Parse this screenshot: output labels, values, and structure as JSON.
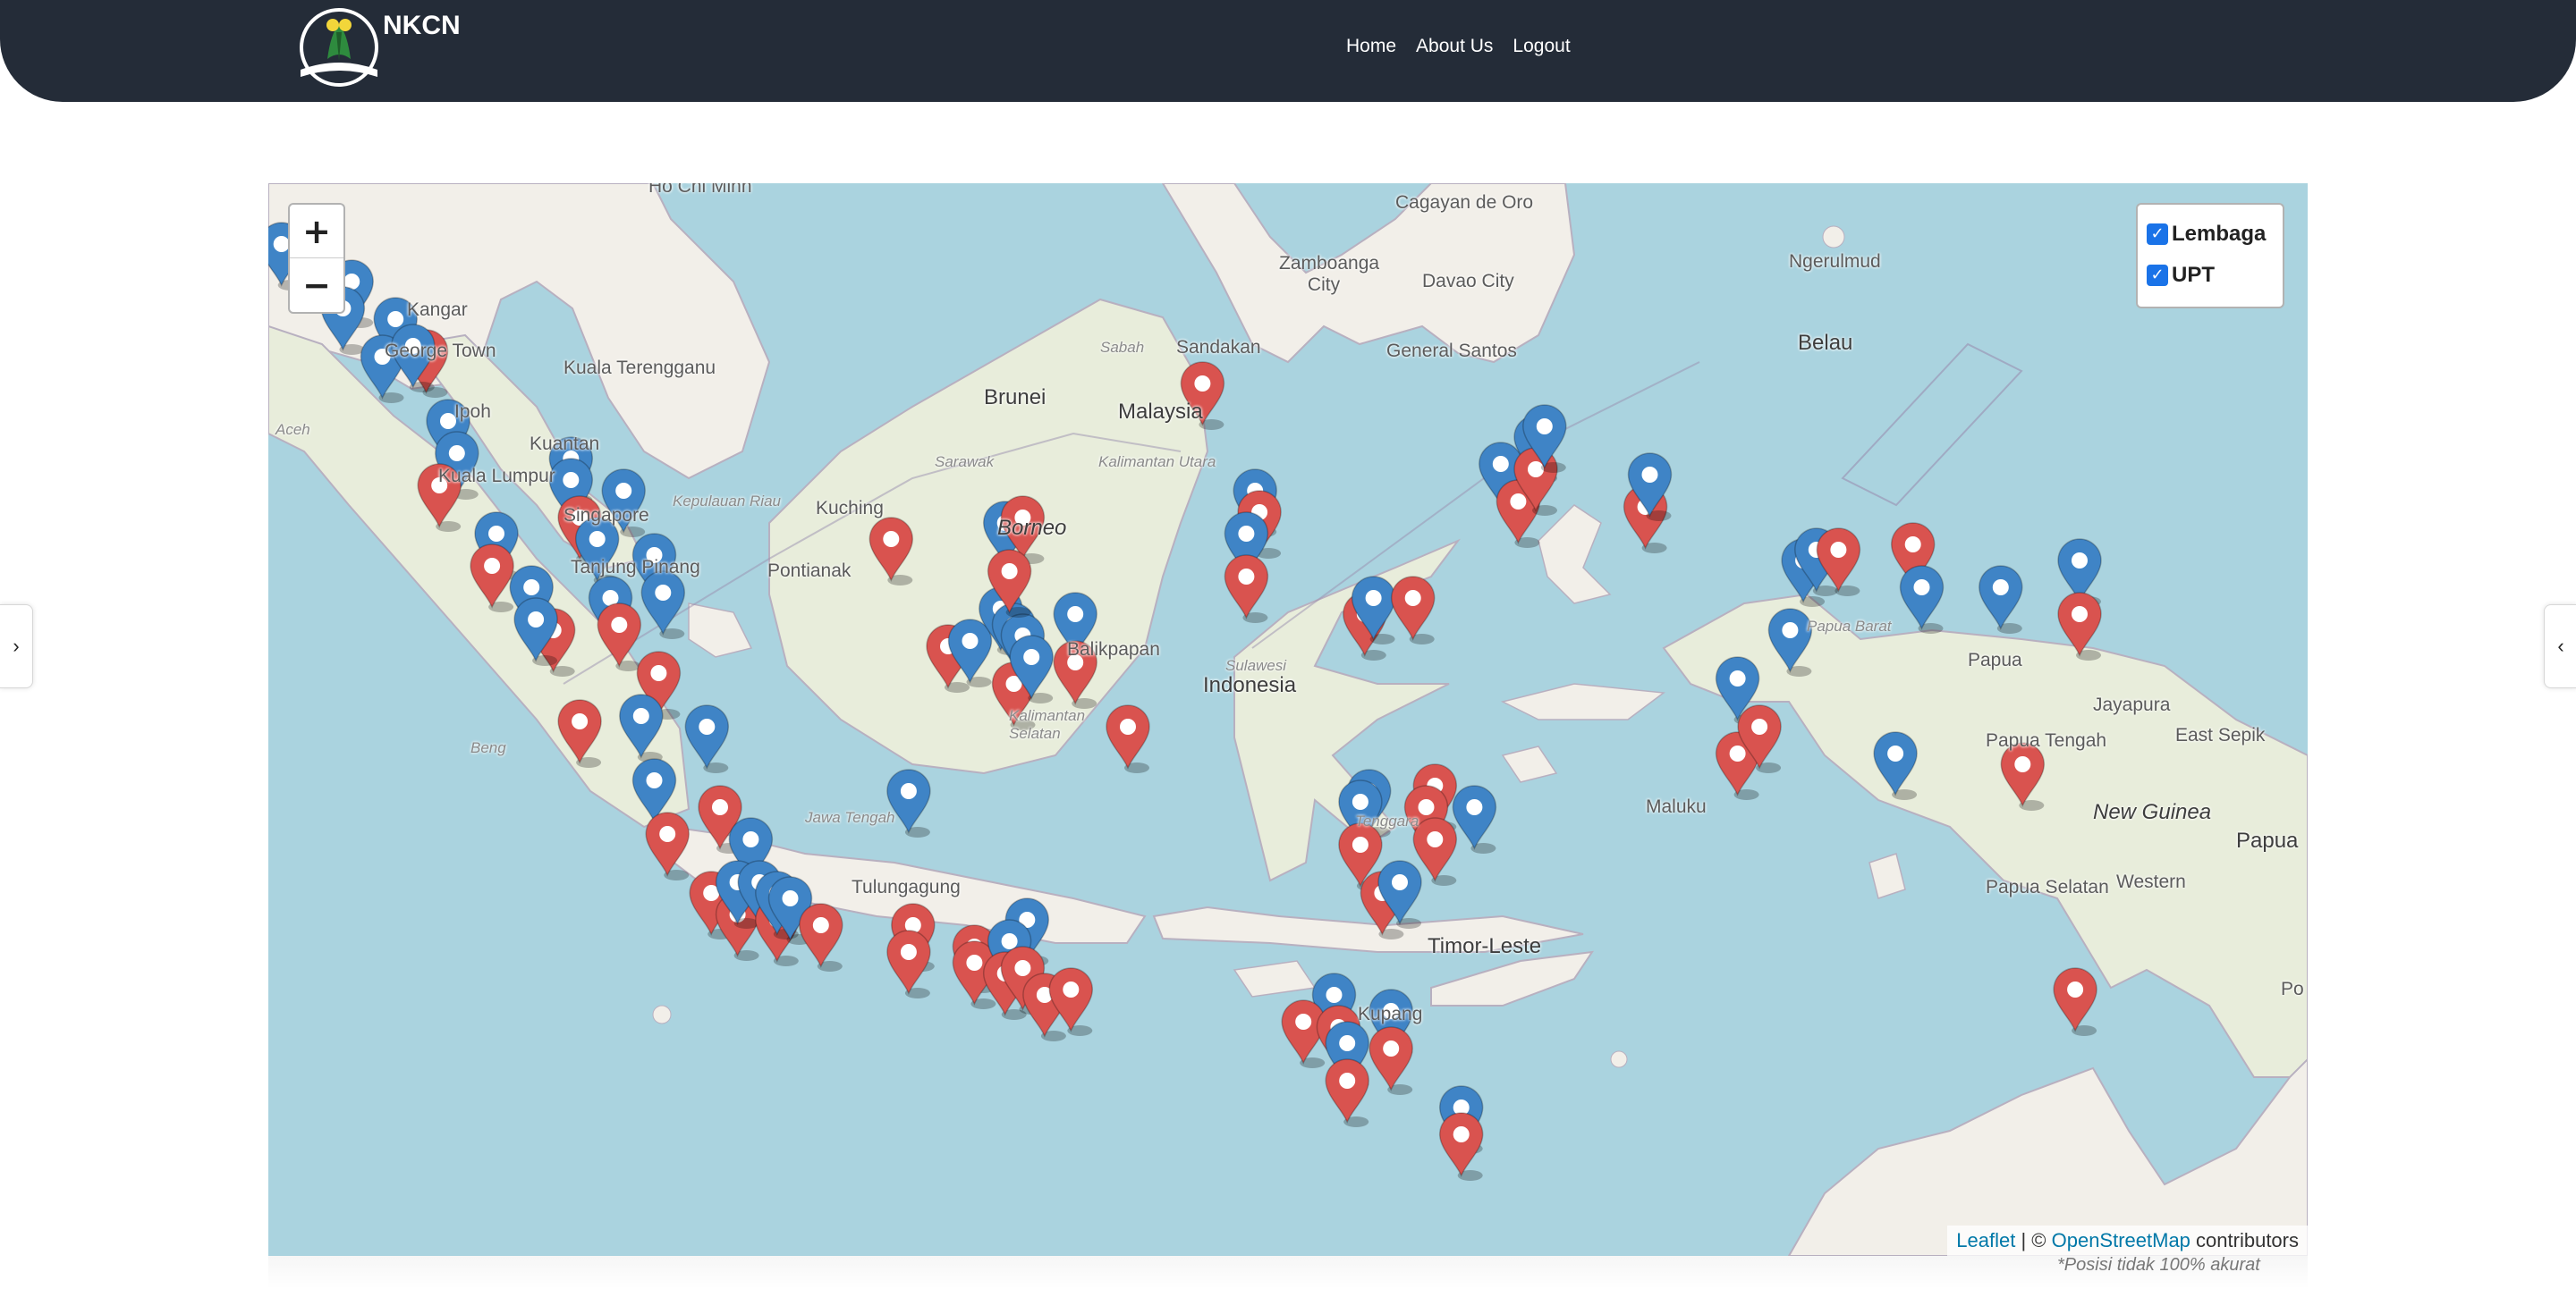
{
  "header": {
    "brand": "NKCN",
    "nav": [
      "Home",
      "About Us",
      "Logout"
    ]
  },
  "map": {
    "zoom_in_label": "+",
    "zoom_out_label": "−",
    "layers": [
      {
        "label": "Lembaga",
        "checked": true,
        "color": "#d9534f"
      },
      {
        "label": "UPT",
        "checked": true,
        "color": "#3f84c6"
      }
    ],
    "attribution": {
      "leaflet": "Leaflet",
      "separator": "| ©",
      "osm": "OpenStreetMap",
      "suffix": "contributors"
    },
    "places": {
      "hochiminh": "Ho Chi Minh",
      "cagayan": "Cagayan de Oro",
      "zamboanga": "Zamboanga City",
      "davao": "Davao City",
      "ngerulmud": "Ngerulmud",
      "kangar": "Kangar",
      "georgetown": "George Town",
      "kualaterengganu": "Kuala Terengganu",
      "sandakan": "Sandakan",
      "generalsantos": "General Santos",
      "belau": "Belau",
      "sabah": "Sabah",
      "brunei": "Brunei",
      "malaysia": "Malaysia",
      "ipoh": "Ipoh",
      "kuantan": "Kuantan",
      "kualalumpur": "Kuala Lumpur",
      "sarawak": "Sarawak",
      "kalimantanutara": "Kalimantan Utara",
      "kuching": "Kuching",
      "borneo": "Borneo",
      "kepulauanriau": "Kepulauan Riau",
      "singapore": "Singapore",
      "tanjungpinang": "Tanjung Pinang",
      "pontianak": "Pontianak",
      "balikpapan": "Balikpapan",
      "sulawesi": "Sulawesi",
      "indonesia": "Indonesia",
      "maluku": "Maluku",
      "papuatengah": "Papua Tengah",
      "papua": "Papua",
      "jayapura": "Jayapura",
      "eastsepik": "East Sepik",
      "newguinea": "New Guinea",
      "papuabig": "Papua",
      "papuaselatan": "Papua Selatan",
      "western": "Western",
      "jawatengah": "Jawa Tengah",
      "tulungagung": "Tulungagung",
      "timorleste": "Timor-Leste",
      "kupang": "Kupang",
      "aceh": "Aceh",
      "bengkulu": "Beng",
      "papuabarat": "Papua Barat",
      "kalselatan": "Kalimantan Selatan",
      "nusatenggara": "Tenggara",
      "po": "Po"
    },
    "markers": [
      {
        "type": "UPT",
        "lat": 5.6,
        "lng": 95.3
      },
      {
        "type": "UPT",
        "lat": 4.9,
        "lng": 96.9
      },
      {
        "type": "UPT",
        "lat": 4.4,
        "lng": 96.7
      },
      {
        "type": "UPT",
        "lat": 4.2,
        "lng": 97.9
      },
      {
        "type": "Lembaga",
        "lat": 3.6,
        "lng": 98.6
      },
      {
        "type": "UPT",
        "lat": 3.5,
        "lng": 97.6
      },
      {
        "type": "UPT",
        "lat": 3.7,
        "lng": 98.3
      },
      {
        "type": "UPT",
        "lat": 2.3,
        "lng": 99.1
      },
      {
        "type": "UPT",
        "lat": 1.7,
        "lng": 99.3
      },
      {
        "type": "Lembaga",
        "lat": 1.1,
        "lng": 98.9
      },
      {
        "type": "UPT",
        "lat": 1.6,
        "lng": 101.9
      },
      {
        "type": "UPT",
        "lat": 1.2,
        "lng": 101.9
      },
      {
        "type": "Lembaga",
        "lat": 0.5,
        "lng": 102.1
      },
      {
        "type": "UPT",
        "lat": 1.0,
        "lng": 103.1
      },
      {
        "type": "UPT",
        "lat": 0.2,
        "lng": 100.2
      },
      {
        "type": "Lembaga",
        "lat": -0.4,
        "lng": 100.1
      },
      {
        "type": "UPT",
        "lat": 0.1,
        "lng": 102.5
      },
      {
        "type": "UPT",
        "lat": -0.2,
        "lng": 103.8
      },
      {
        "type": "UPT",
        "lat": -0.8,
        "lng": 101.0
      },
      {
        "type": "UPT",
        "lat": -1.0,
        "lng": 102.8
      },
      {
        "type": "Lembaga",
        "lat": -1.6,
        "lng": 101.5
      },
      {
        "type": "Lembaga",
        "lat": -1.5,
        "lng": 103.0
      },
      {
        "type": "UPT",
        "lat": -1.4,
        "lng": 101.1
      },
      {
        "type": "UPT",
        "lat": -0.9,
        "lng": 104.0
      },
      {
        "type": "Lembaga",
        "lat": -2.4,
        "lng": 103.9
      },
      {
        "type": "Lembaga",
        "lat": -3.3,
        "lng": 102.1
      },
      {
        "type": "UPT",
        "lat": -3.2,
        "lng": 103.5
      },
      {
        "type": "UPT",
        "lat": -3.4,
        "lng": 105.0
      },
      {
        "type": "UPT",
        "lat": -4.4,
        "lng": 103.8
      },
      {
        "type": "Lembaga",
        "lat": -5.4,
        "lng": 104.1
      },
      {
        "type": "Lembaga",
        "lat": -4.9,
        "lng": 105.3
      },
      {
        "type": "UPT",
        "lat": -5.5,
        "lng": 106.0
      },
      {
        "type": "Lembaga",
        "lat": -6.5,
        "lng": 105.1
      },
      {
        "type": "Lembaga",
        "lat": -6.9,
        "lng": 105.7
      },
      {
        "type": "UPT",
        "lat": -6.3,
        "lng": 105.7
      },
      {
        "type": "UPT",
        "lat": -6.3,
        "lng": 106.2
      },
      {
        "type": "Lembaga",
        "lat": -7.0,
        "lng": 106.6
      },
      {
        "type": "UPT",
        "lat": -6.5,
        "lng": 106.6
      },
      {
        "type": "UPT",
        "lat": -6.6,
        "lng": 106.9
      },
      {
        "type": "Lembaga",
        "lat": -7.1,
        "lng": 107.6
      },
      {
        "type": "UPT",
        "lat": -4.6,
        "lng": 109.6
      },
      {
        "type": "Lembaga",
        "lat": -7.1,
        "lng": 109.7
      },
      {
        "type": "Lembaga",
        "lat": -7.6,
        "lng": 109.6
      },
      {
        "type": "Lembaga",
        "lat": -7.5,
        "lng": 111.1
      },
      {
        "type": "Lembaga",
        "lat": -7.8,
        "lng": 111.1
      },
      {
        "type": "UPT",
        "lat": -7.0,
        "lng": 112.3
      },
      {
        "type": "UPT",
        "lat": -7.4,
        "lng": 111.9
      },
      {
        "type": "Lembaga",
        "lat": -8.0,
        "lng": 111.8
      },
      {
        "type": "Lembaga",
        "lat": -7.9,
        "lng": 112.2
      },
      {
        "type": "Lembaga",
        "lat": -8.4,
        "lng": 112.7
      },
      {
        "type": "Lembaga",
        "lat": -8.3,
        "lng": 113.3
      },
      {
        "type": "Lembaga",
        "lat": 0.1,
        "lng": 109.2
      },
      {
        "type": "Lembaga",
        "lat": -1.9,
        "lng": 110.5
      },
      {
        "type": "UPT",
        "lat": -1.8,
        "lng": 111.0
      },
      {
        "type": "UPT",
        "lat": -1.2,
        "lng": 111.7
      },
      {
        "type": "UPT",
        "lat": -1.5,
        "lng": 112.0
      },
      {
        "type": "UPT",
        "lat": -1.7,
        "lng": 112.2
      },
      {
        "type": "Lembaga",
        "lat": -2.6,
        "lng": 112.0
      },
      {
        "type": "UPT",
        "lat": -2.1,
        "lng": 112.4
      },
      {
        "type": "UPT",
        "lat": 0.4,
        "lng": 111.8
      },
      {
        "type": "Lembaga",
        "lat": 0.5,
        "lng": 112.2
      },
      {
        "type": "Lembaga",
        "lat": -0.5,
        "lng": 111.9
      },
      {
        "type": "UPT",
        "lat": -1.3,
        "lng": 113.4
      },
      {
        "type": "Lembaga",
        "lat": -2.2,
        "lng": 113.4
      },
      {
        "type": "Lembaga",
        "lat": -3.4,
        "lng": 114.6
      },
      {
        "type": "Lembaga",
        "lat": 3.0,
        "lng": 116.3
      },
      {
        "type": "UPT",
        "lat": 1.0,
        "lng": 117.5
      },
      {
        "type": "Lembaga",
        "lat": 0.6,
        "lng": 117.6
      },
      {
        "type": "UPT",
        "lat": 0.2,
        "lng": 117.3
      },
      {
        "type": "Lembaga",
        "lat": -0.6,
        "lng": 117.3
      },
      {
        "type": "Lembaga",
        "lat": -1.3,
        "lng": 120.0
      },
      {
        "type": "UPT",
        "lat": -1.0,
        "lng": 120.2
      },
      {
        "type": "Lembaga",
        "lat": -1.0,
        "lng": 121.1
      },
      {
        "type": "UPT",
        "lat": -4.6,
        "lng": 120.1
      },
      {
        "type": "UPT",
        "lat": -4.8,
        "lng": 119.9
      },
      {
        "type": "Lembaga",
        "lat": -5.6,
        "lng": 119.9
      },
      {
        "type": "Lembaga",
        "lat": -6.5,
        "lng": 120.4
      },
      {
        "type": "UPT",
        "lat": -6.3,
        "lng": 120.8
      },
      {
        "type": "Lembaga",
        "lat": -4.5,
        "lng": 121.6
      },
      {
        "type": "Lembaga",
        "lat": -4.9,
        "lng": 121.4
      },
      {
        "type": "Lembaga",
        "lat": -5.5,
        "lng": 121.6
      },
      {
        "type": "UPT",
        "lat": -4.9,
        "lng": 122.5
      },
      {
        "type": "UPT",
        "lat": 1.5,
        "lng": 123.1
      },
      {
        "type": "Lembaga",
        "lat": 0.8,
        "lng": 123.5
      },
      {
        "type": "UPT",
        "lat": 2.0,
        "lng": 123.9
      },
      {
        "type": "Lembaga",
        "lat": 1.4,
        "lng": 123.9
      },
      {
        "type": "UPT",
        "lat": 2.2,
        "lng": 124.1
      },
      {
        "type": "Lembaga",
        "lat": 0.7,
        "lng": 126.4
      },
      {
        "type": "UPT",
        "lat": 1.3,
        "lng": 126.5
      },
      {
        "type": "UPT",
        "lat": -8.4,
        "lng": 119.3
      },
      {
        "type": "Lembaga",
        "lat": -8.9,
        "lng": 118.6
      },
      {
        "type": "Lembaga",
        "lat": -9.0,
        "lng": 119.4
      },
      {
        "type": "UPT",
        "lat": -9.3,
        "lng": 119.6
      },
      {
        "type": "Lembaga",
        "lat": -10.0,
        "lng": 119.6
      },
      {
        "type": "UPT",
        "lat": -8.7,
        "lng": 120.6
      },
      {
        "type": "Lembaga",
        "lat": -9.4,
        "lng": 120.6
      },
      {
        "type": "UPT",
        "lat": -10.5,
        "lng": 122.2
      },
      {
        "type": "Lembaga",
        "lat": -11.0,
        "lng": 122.2
      },
      {
        "type": "Lembaga",
        "lat": -3.9,
        "lng": 128.5
      },
      {
        "type": "UPT",
        "lat": -2.5,
        "lng": 128.5
      },
      {
        "type": "Lembaga",
        "lat": -3.4,
        "lng": 129.0
      },
      {
        "type": "UPT",
        "lat": -1.6,
        "lng": 129.7
      },
      {
        "type": "UPT",
        "lat": -0.3,
        "lng": 130.0
      },
      {
        "type": "UPT",
        "lat": -0.1,
        "lng": 130.3
      },
      {
        "type": "Lembaga",
        "lat": -0.1,
        "lng": 130.8
      },
      {
        "type": "Lembaga",
        "lat": 0.0,
        "lng": 132.5
      },
      {
        "type": "UPT",
        "lat": -0.8,
        "lng": 132.7
      },
      {
        "type": "UPT",
        "lat": -3.9,
        "lng": 132.1
      },
      {
        "type": "UPT",
        "lat": -0.8,
        "lng": 134.5
      },
      {
        "type": "UPT",
        "lat": -0.3,
        "lng": 136.3
      },
      {
        "type": "Lembaga",
        "lat": -1.3,
        "lng": 136.3
      },
      {
        "type": "Lembaga",
        "lat": -4.1,
        "lng": 135.0
      },
      {
        "type": "Lembaga",
        "lat": -8.3,
        "lng": 136.2
      }
    ]
  },
  "note": "*Posisi tidak 100% akurat"
}
